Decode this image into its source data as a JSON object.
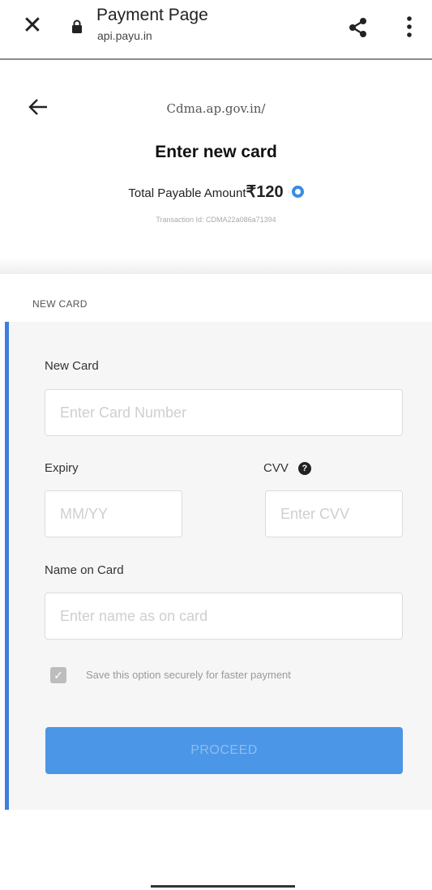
{
  "browser": {
    "title": "Payment Page",
    "url": "api.payu.in"
  },
  "header": {
    "merchant": "Cdma.ap.gov.in/",
    "heading": "Enter new card",
    "amount_label": "Total Payable Amount",
    "amount_value": "₹120",
    "transaction": "Transaction Id: CDMA22a086a71394"
  },
  "section_label": "NEW CARD",
  "form": {
    "card_label": "New Card",
    "card_placeholder": "Enter Card Number",
    "expiry_label": "Expiry",
    "expiry_placeholder": "MM/YY",
    "cvv_label": "CVV",
    "cvv_help": "?",
    "cvv_placeholder": "Enter CVV",
    "name_label": "Name on Card",
    "name_placeholder": "Enter name as on card",
    "save_text": "Save this option securely for faster payment",
    "save_checked": true,
    "proceed_label": "PROCEED"
  },
  "colors": {
    "accent": "#3f7ede",
    "button": "#4b96e6"
  }
}
